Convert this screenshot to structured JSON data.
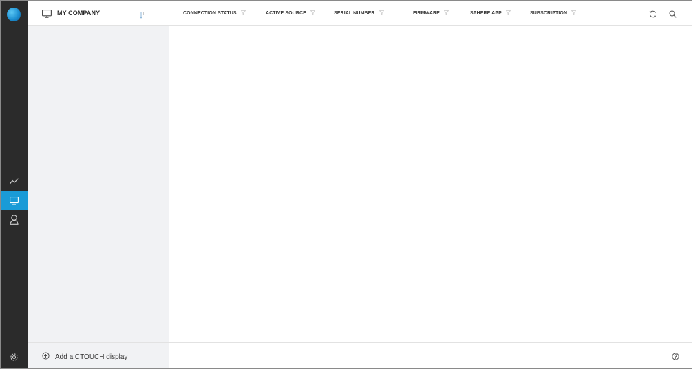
{
  "rail": {
    "items": [
      {
        "name": "analytics",
        "icon": "trend-line-icon"
      },
      {
        "name": "displays",
        "icon": "monitor-icon",
        "active": true
      },
      {
        "name": "users",
        "icon": "user-icon"
      },
      {
        "name": "settings",
        "icon": "gear-icon"
      }
    ],
    "accent_color": "#1a9bd7",
    "background_color": "#2b2b2b"
  },
  "panel": {
    "title": "MY COMPANY",
    "icon": "monitor-icon",
    "sort_icon": "sort-icon"
  },
  "columns": [
    {
      "label": "CONNECTION STATUS"
    },
    {
      "label": "ACTIVE SOURCE"
    },
    {
      "label": "SERIAL NUMBER"
    },
    {
      "label": "FIRMWARE"
    },
    {
      "label": "SPHERE APP"
    },
    {
      "label": "SUBSCRIPTION"
    }
  ],
  "toolbar": {
    "refresh_icon": "refresh-icon",
    "search_icon": "search-icon"
  },
  "footer": {
    "add_label": "Add a CTOUCH display",
    "add_icon": "plus-circle-icon",
    "help_icon": "help-circle-icon"
  }
}
